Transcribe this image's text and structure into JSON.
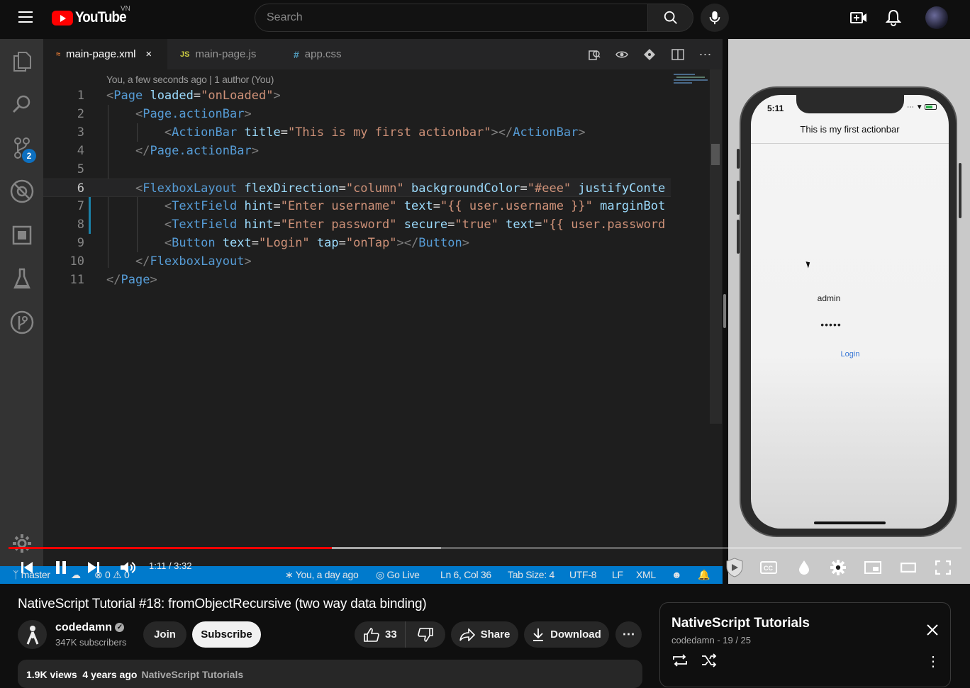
{
  "header": {
    "logo_text": "YouTube",
    "region": "VN",
    "search_placeholder": "Search"
  },
  "vscode": {
    "tabs": [
      {
        "icon": "≈",
        "label": "main-page.xml",
        "close": "×"
      },
      {
        "icon": "JS",
        "label": "main-page.js"
      },
      {
        "icon": "#",
        "label": "app.css"
      }
    ],
    "blame": "You, a few seconds ago | 1 author (You)",
    "line_numbers": [
      "1",
      "2",
      "3",
      "4",
      "5",
      "6",
      "7",
      "8",
      "9",
      "10",
      "11"
    ],
    "badge_count": "2",
    "status": {
      "branch": "master",
      "errors": "0",
      "warnings": "0",
      "blame": "You, a day ago",
      "golive": "Go Live",
      "position": "Ln 6, Col 36",
      "tabsize": "Tab Size: 4",
      "encoding": "UTF-8",
      "eol": "LF",
      "language": "XML"
    }
  },
  "simulator": {
    "time": "5:11",
    "actionbar_title": "This is my first actionbar",
    "username_value": "admin",
    "password_value": "•••••",
    "login_label": "Login"
  },
  "player": {
    "time": "1:11 / 3:32",
    "progress_played": 0.339,
    "progress_buffered": 0.454
  },
  "video": {
    "title": "NativeScript Tutorial #18: fromObjectRecursive (two way data binding)",
    "channel": "codedamn",
    "subscribers": "347K subscribers",
    "join_label": "Join",
    "subscribe_label": "Subscribe",
    "likes": "33",
    "share_label": "Share",
    "download_label": "Download",
    "views": "1.9K views",
    "age": "4 years ago",
    "playlist_link": "NativeScript Tutorials"
  },
  "playlist": {
    "title": "NativeScript Tutorials",
    "subtitle": "codedamn - 19 / 25"
  },
  "colors": {
    "youtube_red": "#ff0000",
    "vscode_blue": "#007acc",
    "xml_tag": "#569cd6",
    "xml_attr": "#9cdcfe",
    "xml_value": "#ce9178"
  }
}
